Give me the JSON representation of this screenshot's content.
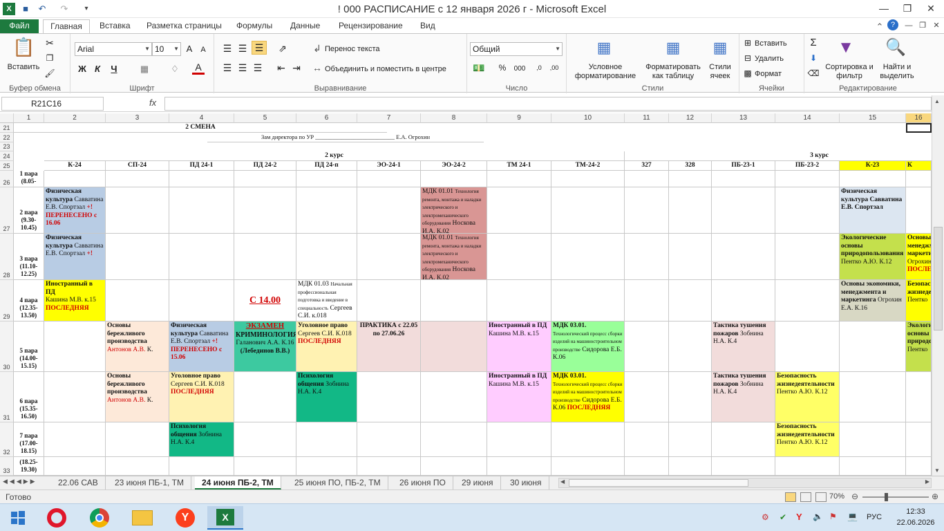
{
  "window": {
    "title": "! 000 РАСПИСАНИЕ с 12 января 2026 г  -  Microsoft Excel"
  },
  "tabs": [
    "Файл",
    "Главная",
    "Вставка",
    "Разметка страницы",
    "Формулы",
    "Данные",
    "Рецензирование",
    "Вид"
  ],
  "ribbon": {
    "paste": "Вставить",
    "clipboard": "Буфер обмена",
    "font_name": "Arial",
    "font_size": "10",
    "font_group": "Шрифт",
    "bold": "Ж",
    "italic": "К",
    "underline": "Ч",
    "wrap": "Перенос текста",
    "merge": "Объединить и поместить в центре",
    "align_group": "Выравнивание",
    "number_format": "Общий",
    "number_group": "Число",
    "cond_format": "Условное форматирование",
    "format_table": "Форматировать как таблицу",
    "cell_styles": "Стили ячеек",
    "styles_group": "Стили",
    "insert": "Вставить",
    "delete": "Удалить",
    "format": "Формат",
    "cells_group": "Ячейки",
    "sort": "Сортировка и фильтр",
    "find": "Найти и выделить",
    "edit_group": "Редактирование"
  },
  "formula_bar": {
    "name_box": "R21C16",
    "fx": "fx",
    "value": ""
  },
  "columns": [
    "1",
    "2",
    "3",
    "4",
    "5",
    "6",
    "7",
    "8",
    "9",
    "10",
    "11",
    "12",
    "13",
    "14",
    "15",
    "16"
  ],
  "rows": [
    "21",
    "22",
    "23",
    "24",
    "25",
    "26",
    "27",
    "28",
    "29",
    "30",
    "31",
    "32",
    "33"
  ],
  "sheet": {
    "shift": "2 СМЕНА",
    "director": "Зам директора по УР ___________________________ Е.А. Огрохин",
    "course2": "2 курс",
    "course3": "3 курс",
    "groups": [
      "К-24",
      "СП-24",
      "ПД 24-1",
      "ПД 24-2",
      "ПД 24-п",
      "ЭО-24-1",
      "ЭО-24-2",
      "ТМ 24-1",
      "ТМ-24-2",
      "327",
      "328",
      "ПБ-23-1",
      "ПБ-23-2",
      "К-23",
      "К"
    ],
    "pairs": [
      "1 пара (8.05-",
      "2 пара (9.30-10.45)",
      "3 пара (11.10-12.25)",
      "4 пара (12.35-13.50)",
      "5 пара (14.00-15.15)",
      "6 пара (15.35-16.50)",
      "7 пара (17.00-18.15)",
      "(18.25-19.30)"
    ],
    "c": {
      "k24_2a": "Физическая культура",
      "k24_2b": " Савватина Е.В. Спортзал ",
      "k24_2c": "+!",
      "k24_2d": "ПЕРЕНЕСЕНО с 16.06",
      "k24_3a": "Физическая культура",
      "k24_3b": " Савватина Е.В. Спортзал ",
      "k24_3c": "+!",
      "k24_4a": "Иностранный в ПД",
      "k24_4b": "Кашина М.В. к.15",
      "k24_4c": "ПОСЛЕДНЯЯ",
      "eo2_2a": "МДК 01.01 ",
      "eo2_2b": "Технология ремонта, монтажа и наладки электрического и электромеханического оборудования",
      "eo2_2c": " Носкова И.А. К.02",
      "eo2_3a": "МДК 01.01 ",
      "eo2_3b": "Технология ремонта, монтажа и наладки электрического и электромеханического оборудования",
      "eo2_3c": " Носкова И.А. К.02",
      "k23_2a": "Физическая культура",
      "k23_2b": " Савватина Е.В. Спортзал",
      "k23_3a": "Экологические основы природопользования",
      "k23_3b": " Пентко А.Ю. К.12",
      "k_3a": "Основы менеджмента маркетинга",
      "k_3b": " Огрохин",
      "k_3c": "ПОСЛЕД",
      "pdp_4a": "МДК 01.03 ",
      "pdp_4b": "Начальная профессиональная подготовка и введение в специальность",
      "pdp_4c": " Сергеев С.И. к.018",
      "pd2_4": "С 14.00",
      "k23_4a": "Основы экономики, менеджмента и маркетинга",
      "k23_4b": " Огрохин Е.А. К.16",
      "k_4a": "Безопасность жизнедеятельности",
      "k_4b": " Пентко",
      "sp_5a": "Основы бережливого производства",
      "sp_5b": "Антонов А.В.",
      "sp_5c": " К.",
      "pd1_5a": "Физическая культура",
      "pd1_5b": " Савватина Е.В. Спортзал ",
      "pd1_5c": "+!",
      "pd1_5d": "ПЕРЕНЕСЕНО с 15.06",
      "pd2_5a": "ЭКЗАМЕН",
      "pd2_5b": "КРИМИНОЛОГИЯ",
      "pd2_5c": "Галанович А.А. К.16",
      "pd2_5d": "(Лебединов В.В.)",
      "pdp_5a": "Уголовное право",
      "pdp_5b": " Сергеев С.И. К.018 ",
      "pdp_5c": "ПОСЛЕДНЯЯ",
      "eo1_5a": "ПРАКТИКА  с 22.05 по 27.06.26",
      "tm1_5a": "Иностранный в ПД",
      "tm1_5b": "Кашина М.В. к.15",
      "tm2_5a": "МДК 03.01.",
      "tm2_5b": "Технологический процесс сборки изделий на машиностроительном производстве",
      "tm2_5c": " Сидорова Е.Б. К.06",
      "pb1_5a": "Тактика тушения пожаров",
      "pb1_5b": " Зобнина Н.А. К.4",
      "k_5a": "Экологич основы природо",
      "k_5b": "я Пентко",
      "sp_6a": "Основы бережливого производства",
      "sp_6b": "Антонов А.В.",
      "sp_6c": " К.",
      "pd1_6a": "Уголовное право",
      "pd1_6b": " Сергеев С.И. К.018 ",
      "pd1_6c": "ПОСЛЕДНЯЯ",
      "pdp_6a": "Психология общения",
      "pdp_6b": " Зобнина Н.А. К.4",
      "tm1_6a": "Иностранный в ПД",
      "tm1_6b": "Кашина М.В. к.15",
      "tm2_6a": "МДК 03.01.",
      "tm2_6b": "Технологический процесс сборки изделий на машиностроительном производстве",
      "tm2_6c": " Сидорова Е.Б. К.06 ",
      "tm2_6d": "ПОСЛЕДНЯЯ",
      "pb1_6a": "Тактика тушения пожаров",
      "pb1_6b": " Зобнина Н.А. К.4",
      "pb2_6a": "Безопасность жизнедеятельности",
      "pb2_6b": " Пентко А.Ю. К.12",
      "pd1_7a": "Психология общения",
      "pd1_7b": " Зобнина Н.А. К.4",
      "pb2_7a": "Безопасность жизнедеятельности",
      "pb2_7b": " Пентко А.Ю. К.12"
    }
  },
  "sheet_tabs": [
    "22.06 САВ",
    "23 июня ПБ-1, ТМ",
    "24 июня ПБ-2, ТМ",
    "25 июня ПО, ПБ-2, ТМ",
    "26 июня ПО",
    "29 июня",
    "30 июня"
  ],
  "status": {
    "ready": "Готово",
    "zoom": "70%"
  },
  "taskbar": {
    "lang": "РУС",
    "time": "12:33",
    "date": "22.06.2026"
  }
}
